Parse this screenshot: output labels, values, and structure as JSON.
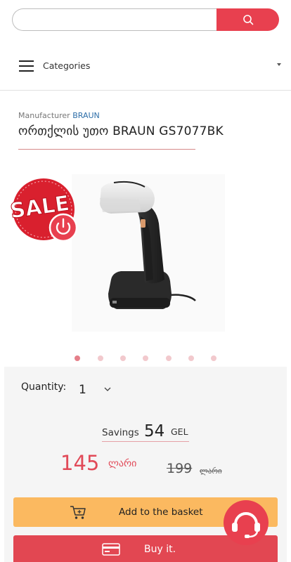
{
  "search": {
    "placeholder": "",
    "value": ""
  },
  "nav": {
    "categories_label": "Categories"
  },
  "product": {
    "manufacturer_prefix": "Manufacturer",
    "manufacturer_name": "BRAUN",
    "title": "ორთქლის უთო BRAUN GS7077BK",
    "sale_badge_text": "SALE"
  },
  "gallery": {
    "dots_count": 7,
    "active_index": 0
  },
  "purchase": {
    "quantity_label": "Quantity:",
    "quantity_value": "1",
    "savings_label": "Savings",
    "savings_amount": "54",
    "savings_currency": "GEL",
    "price": "145",
    "price_currency": "ლარი",
    "old_price": "199",
    "old_price_currency": "ლარი",
    "add_to_basket_label": "Add to the basket",
    "buy_label": "Buy it."
  },
  "colors": {
    "accent": "#e8404f",
    "basket_button": "#fbb960",
    "price": "#e14a58",
    "link": "#2d6ea8"
  }
}
